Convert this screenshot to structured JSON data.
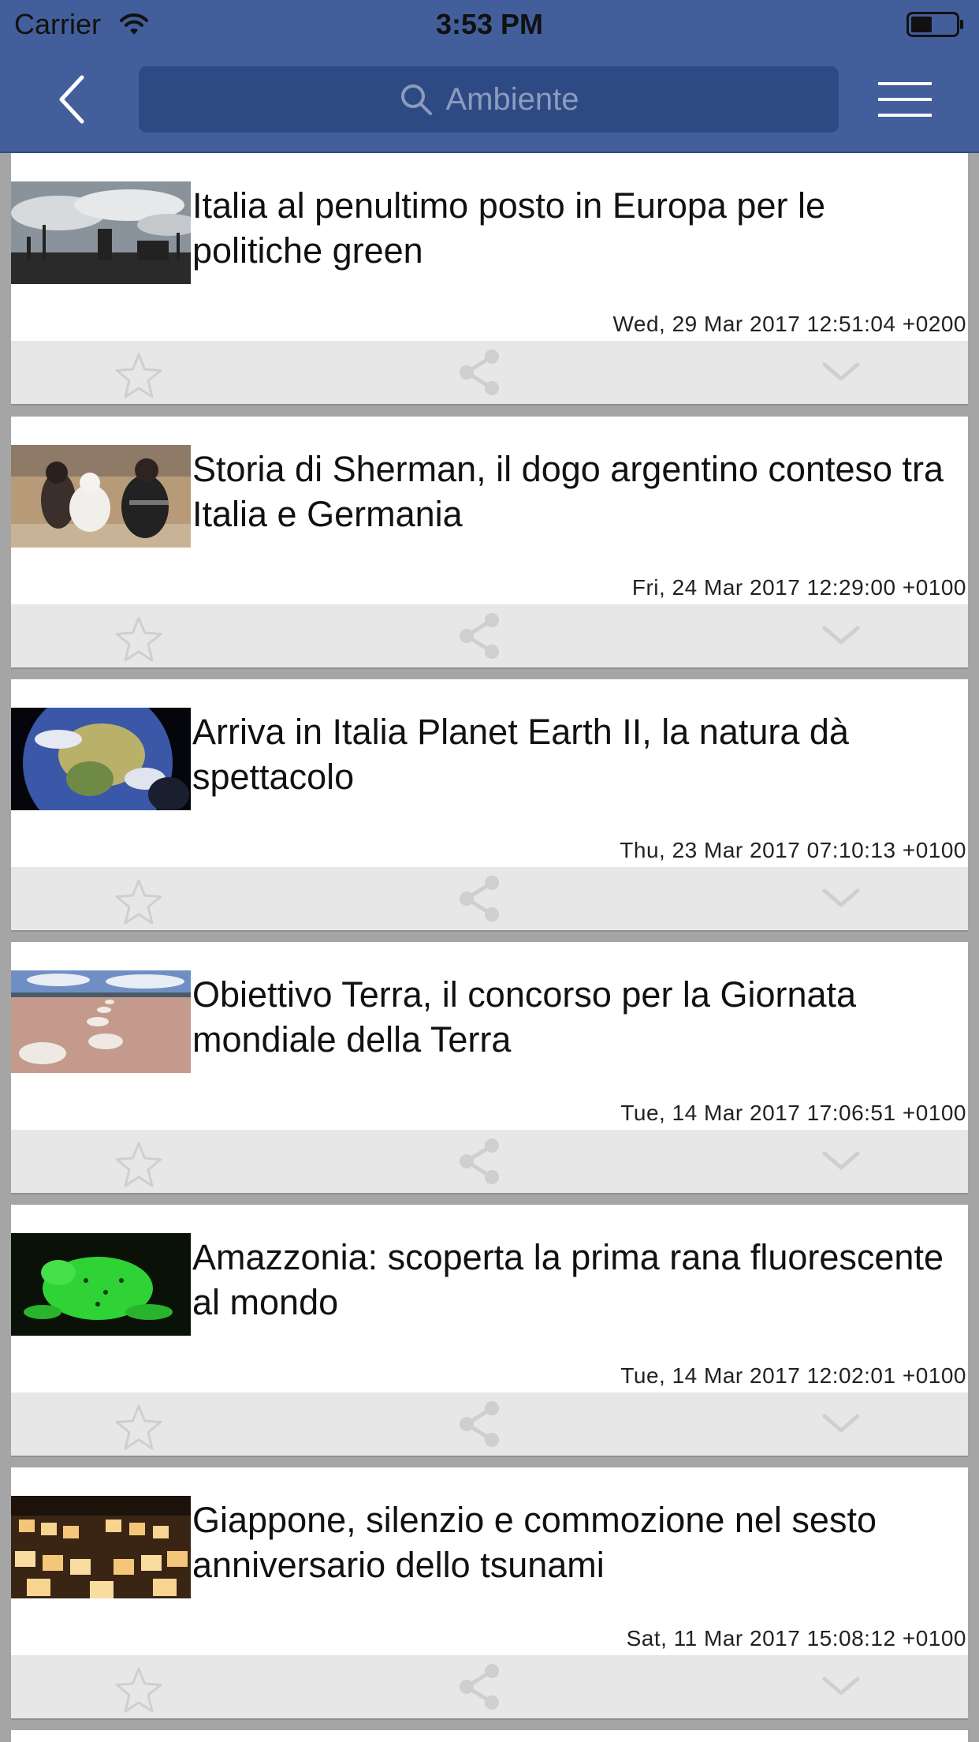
{
  "status_bar": {
    "carrier": "Carrier",
    "time": "3:53 PM",
    "wifi_icon": "wifi-icon",
    "battery_icon": "battery-icon"
  },
  "nav": {
    "back_icon": "chevron-left-icon",
    "search_icon": "magnifier-icon",
    "search_placeholder": "Ambiente",
    "menu_icon": "hamburger-menu-icon"
  },
  "colors": {
    "nav_background": "#425f9b",
    "search_field": "#2d4a84",
    "feed_background": "#a5a5a5",
    "action_bar": "#e7e7e7",
    "action_icon": "#cfcfcf"
  },
  "articles": [
    {
      "title": "Italia al penultimo posto in Europa per le politiche green",
      "date": "Wed, 29 Mar 2017 12:51:04 +0200",
      "thumbnail": "industrial skyline under cloudy sky"
    },
    {
      "title": "Storia di Sherman, il dogo argentino conteso tra Italia e Germania",
      "date": "Fri, 24 Mar 2017 12:29:00 +0100",
      "thumbnail": "two people with a white dog on sand"
    },
    {
      "title": "Arriva in Italia Planet Earth II, la natura dà spettacolo",
      "date": "Thu, 23 Mar 2017 07:10:13 +0100",
      "thumbnail": "planet earth seen from space"
    },
    {
      "title": "Obiettivo Terra, il concorso per la Giornata mondiale della Terra",
      "date": "Tue, 14 Mar 2017 17:06:51 +0100",
      "thumbnail": "salt flat with white salt rings"
    },
    {
      "title": "Amazzonia: scoperta la prima rana fluorescente al mondo",
      "date": "Tue, 14 Mar 2017 12:02:01 +0100",
      "thumbnail": "fluorescent green frog"
    },
    {
      "title": "Giappone, silenzio e commozione nel sesto anniversario dello tsunami",
      "date": "Sat, 11 Mar 2017 15:08:12 +0100",
      "thumbnail": "rows of lit paper lanterns"
    }
  ],
  "card_actions": {
    "favorite_icon": "star-outline-icon",
    "share_icon": "share-icon",
    "expand_icon": "chevron-down-icon"
  }
}
